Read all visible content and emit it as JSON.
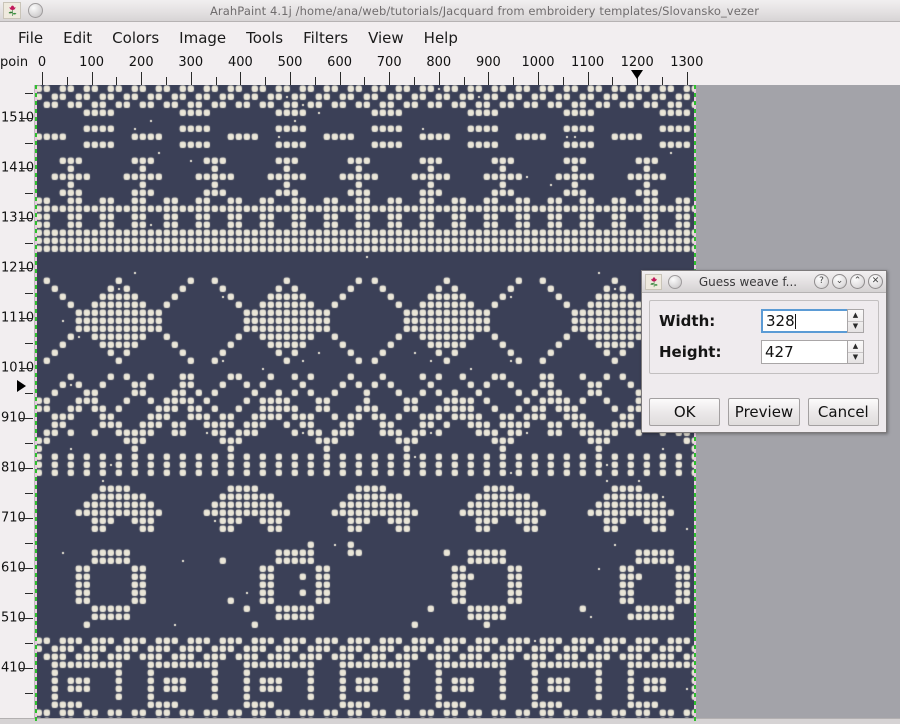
{
  "window": {
    "title": "ArahPaint 4.1j /home/ana/web/tutorials/Jacquard from embroidery templates/Slovansko_vezer",
    "app_icon": "tulip-icon"
  },
  "menubar": {
    "items": [
      {
        "label": "File"
      },
      {
        "label": "Edit"
      },
      {
        "label": "Colors"
      },
      {
        "label": "Image"
      },
      {
        "label": "Tools"
      },
      {
        "label": "Filters"
      },
      {
        "label": "View"
      },
      {
        "label": "Help"
      }
    ]
  },
  "rulers": {
    "unit_label": "poin",
    "horizontal": {
      "labels": [
        "0",
        "100",
        "200",
        "300",
        "400",
        "500",
        "600",
        "700",
        "800",
        "900",
        "1000",
        "1100",
        "1200",
        "1300"
      ],
      "marker_value": "1200"
    },
    "vertical": {
      "labels": [
        "1510",
        "1410",
        "1310",
        "1210",
        "1110",
        "1010",
        "910",
        "810",
        "710",
        "610",
        "510",
        "410"
      ],
      "marker_value": "970"
    }
  },
  "canvas": {
    "background_color": "#3b4057",
    "dot_color": "#eae6d8",
    "desktop_color": "#a3a3a9",
    "selection_border_colors": [
      "#2ec02e",
      "#e8c8e0"
    ]
  },
  "dialog": {
    "title": "Guess weave f...",
    "app_icon": "tulip-icon",
    "window_buttons": [
      {
        "name": "help-button",
        "glyph": "?"
      },
      {
        "name": "minimize-button",
        "glyph": "⌄"
      },
      {
        "name": "maximize-button",
        "glyph": "⌃"
      },
      {
        "name": "close-button",
        "glyph": "✕"
      }
    ],
    "fields": [
      {
        "label": "Width:",
        "value": "328",
        "focused": true
      },
      {
        "label": "Height:",
        "value": "427",
        "focused": false
      }
    ],
    "buttons": [
      {
        "label": "OK"
      },
      {
        "label": "Preview"
      },
      {
        "label": "Cancel"
      }
    ]
  }
}
